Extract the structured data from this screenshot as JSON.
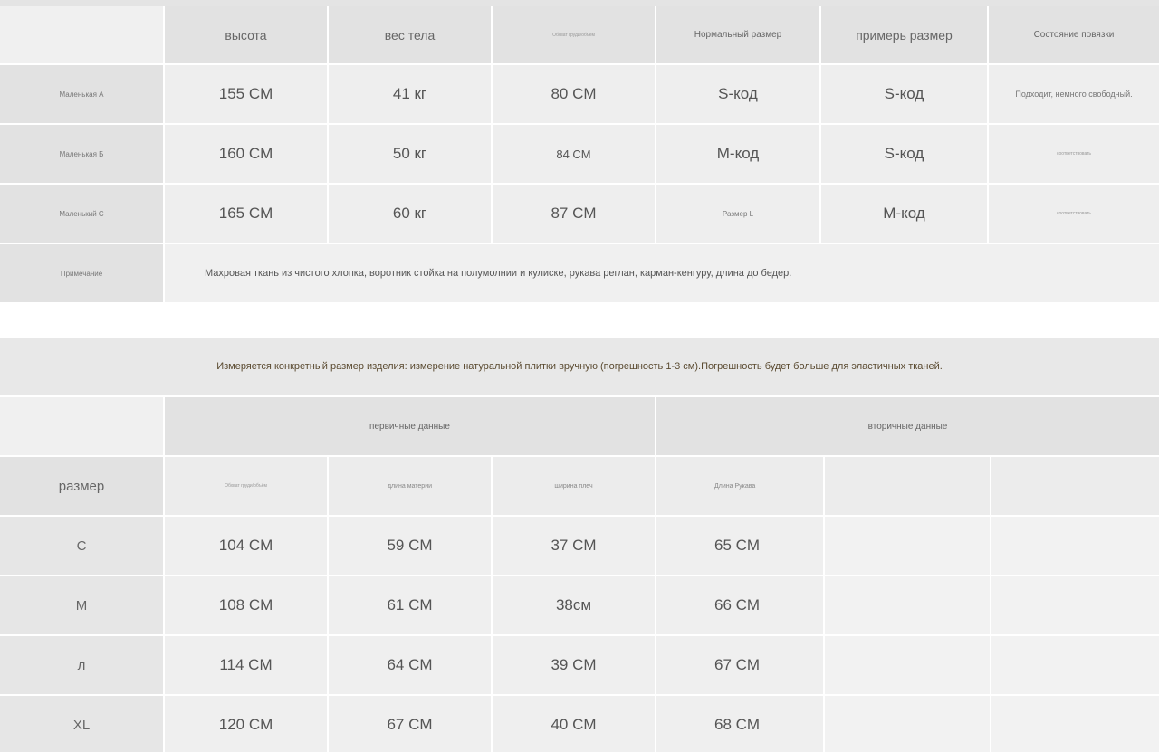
{
  "size_table": {
    "headers": [
      "высота",
      "вес тела",
      "Обхват груди/объём",
      "Нормальный размер",
      "примерь размер",
      "Состояние повязки"
    ],
    "rows": [
      {
        "label": "Маленькая A",
        "height": "155 CM",
        "weight": "41 кг",
        "bust": "80 CM",
        "normal": "S-код",
        "tried": "S-код",
        "fit": "Подходит, немного свободный."
      },
      {
        "label": "Маленькая Б",
        "height": "160 CM",
        "weight": "50 кг",
        "bust": "84 CM",
        "normal": "M-код",
        "tried": "S-код",
        "fit": "соответствовать"
      },
      {
        "label": "Маленький C",
        "height": "165 CM",
        "weight": "60 кг",
        "bust": "87 CM",
        "normal": "Размер L",
        "tried": "M-код",
        "fit": "соответствовать"
      }
    ],
    "note_label": "Примечание",
    "note_text": "Махровая ткань из чистого хлопка, воротник стойка на полумолнии и кулиске, рукава реглан, карман-кенгуру, длина до бедер."
  },
  "banner": "Измеряется конкретный размер изделия: измерение натуральной плитки вручную (погрешность 1-3 см).Погрешность будет больше для эластичных тканей.",
  "measure_table": {
    "group_primary": "первичные данные",
    "group_secondary": "вторичные данные",
    "size_header": "размер",
    "subheaders": [
      "Обхват груди/объём",
      "длина материи",
      "ширина плеч",
      "Длина Рукава"
    ],
    "rows": [
      {
        "size": "C",
        "bust": "104 CM",
        "length": "59 CM",
        "shoulder": "37 CM",
        "sleeve": "65 CM"
      },
      {
        "size": "M",
        "bust": "108 CM",
        "length": "61 CM",
        "shoulder": "38см",
        "sleeve": "66 CM"
      },
      {
        "size": "л",
        "bust": "114 CM",
        "length": "64 CM",
        "shoulder": "39 CM",
        "sleeve": "67 CM"
      },
      {
        "size": "XL",
        "bust": "120 CM",
        "length": "67 CM",
        "shoulder": "40 CM",
        "sleeve": "68 CM"
      }
    ]
  }
}
